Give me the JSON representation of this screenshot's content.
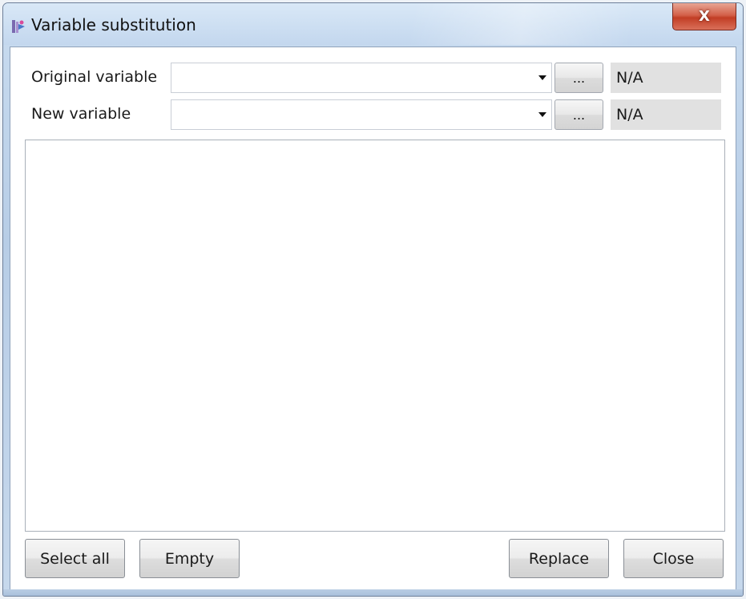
{
  "window": {
    "title": "Variable substitution",
    "close_glyph": "X"
  },
  "form": {
    "original_label": "Original variable",
    "original_value": "",
    "original_browse": "...",
    "original_status": "N/A",
    "new_label": "New variable",
    "new_value": "",
    "new_browse": "...",
    "new_status": "N/A"
  },
  "list": {
    "items": []
  },
  "buttons": {
    "select_all": "Select all",
    "empty": "Empty",
    "replace": "Replace",
    "close": "Close"
  },
  "colors": {
    "close_button": "#c23e25",
    "status_box": "#e1e1e1"
  }
}
